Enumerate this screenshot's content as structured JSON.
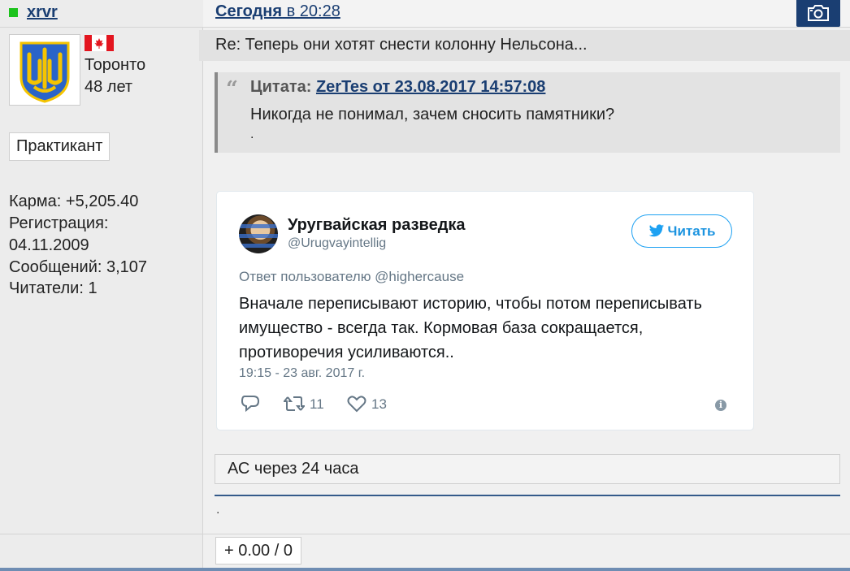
{
  "user": {
    "name": "xrvr",
    "city": "Торонто",
    "age": "48 лет",
    "rank": "Практикант",
    "stats": [
      "Карма: +5,205.40",
      "Регистрация:",
      "04.11.2009",
      "Сообщений: 3,107",
      "Читатели: 1"
    ]
  },
  "post": {
    "date_today": "Сегодня",
    "date_rest": " в 20:28",
    "subject": "Re: Теперь они хотят снести колонну Нельсона...",
    "quote": {
      "mark": "“",
      "prefix": "Цитата: ",
      "link": "ZerTes от 23.08.2017 14:57:08",
      "text": "Никогда не понимал, зачем сносить памятники?",
      "dot": "."
    },
    "note": "АС через 24 часа",
    "signature_dot": ".",
    "rating": "+ 0.00 / 0"
  },
  "tweet": {
    "name": "Уругвайская разведка",
    "handle": "@Urugvayintellig",
    "follow_label": "Читать",
    "reply_to": "Ответ пользователю @highercause",
    "body": "Вначале переписывают историю, чтобы потом переписывать имущество - всегда так. Кормовая база сокращается, противоречия усиливаются..",
    "time": "19:15 - 23 авг. 2017 г.",
    "retweets": "11",
    "likes": "13"
  },
  "icons": {
    "online": "online-status-icon",
    "camera": "camera-icon",
    "flag": "canada-flag-icon",
    "twitter": "twitter-bird-icon",
    "reply": "reply-icon",
    "retweet": "retweet-icon",
    "like": "heart-icon",
    "info": "info-icon"
  },
  "colors": {
    "link": "#1a3e72",
    "online": "#1dc31d",
    "twitter_blue": "#1da1f2",
    "accent_bar": "#345a8a"
  }
}
